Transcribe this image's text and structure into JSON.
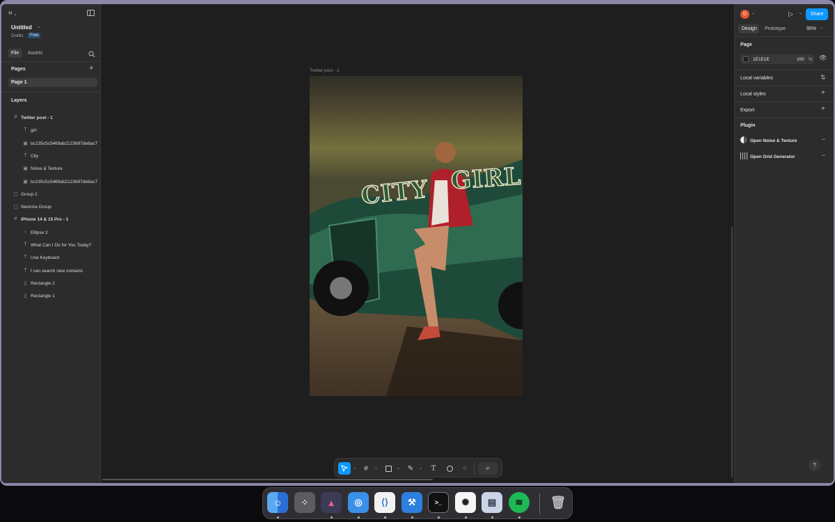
{
  "file": {
    "name": "Untitled",
    "location": "Drafts",
    "plan_badge": "Free"
  },
  "left_tabs": {
    "file": "File",
    "assets": "Assets"
  },
  "pages": {
    "title": "Pages",
    "items": [
      "Page 1"
    ]
  },
  "layers": {
    "title": "Layers",
    "items": [
      {
        "label": "Twitter post - 1",
        "icon": "frame-icon",
        "level": 0,
        "bold": true
      },
      {
        "label": "girl",
        "icon": "text-icon",
        "level": 1
      },
      {
        "label": "bc235c5c5469ab2123697de8ac7",
        "icon": "image-icon",
        "level": 1
      },
      {
        "label": "City",
        "icon": "text-icon",
        "level": 1
      },
      {
        "label": "Noise & Texture",
        "icon": "image-icon",
        "level": 1
      },
      {
        "label": "bc235c5c5469ab2123697de8ac7",
        "icon": "image-icon",
        "level": 1
      },
      {
        "label": "Group 2",
        "icon": "group-icon",
        "level": 0
      },
      {
        "label": "Neonize Group",
        "icon": "group-icon",
        "level": 0
      },
      {
        "label": "iPhone 14 & 15 Pro - 1",
        "icon": "frame-icon",
        "level": 0,
        "bold": true
      },
      {
        "label": "Ellipse 2",
        "icon": "ellipse-icon",
        "level": 1
      },
      {
        "label": "What Can I Do for You Today?",
        "icon": "text-icon",
        "level": 1
      },
      {
        "label": "Use Keyboard",
        "icon": "text-icon",
        "level": 1
      },
      {
        "label": "I can search new contacts",
        "icon": "text-icon",
        "level": 1
      },
      {
        "label": "Rectangle 2",
        "icon": "rectangle-icon",
        "level": 1
      },
      {
        "label": "Rectangle 1",
        "icon": "rectangle-icon",
        "level": 1
      }
    ]
  },
  "canvas": {
    "frame_label": "Twitter post - 1",
    "artwork_text_1": "CITY",
    "artwork_text_2": "GIRL"
  },
  "right": {
    "avatar_letter": "D",
    "share": "Share",
    "tabs": {
      "design": "Design",
      "prototype": "Prototype"
    },
    "zoom": "95%",
    "page_title": "Page",
    "page_color": "1E1E1E",
    "opacity": "100",
    "opacity_unit": "%",
    "sections": {
      "local_variables": "Local variables",
      "local_styles": "Local styles",
      "export": "Export",
      "plugin": "Plugin"
    },
    "plugins": [
      "Open Noise & Texture",
      "Open Grid Generator"
    ],
    "help": "?"
  },
  "dock": {
    "apps": [
      "finder",
      "launchpad",
      "affinity",
      "safari",
      "vscode",
      "xcode",
      "terminal",
      "chatgpt",
      "preview",
      "spotify",
      "trash"
    ]
  },
  "colors": {
    "accent": "#0d99ff",
    "share_button": "#0d99ff",
    "avatar": "#e4572e",
    "artwork_text": "#2e5a32"
  }
}
